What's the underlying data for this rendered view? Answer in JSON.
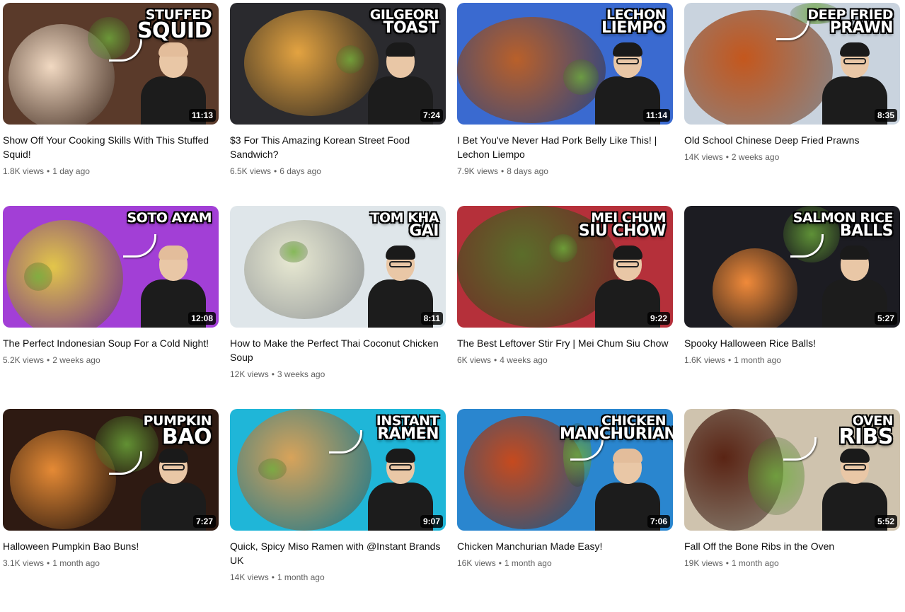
{
  "videos": [
    {
      "thumb_text_1": "Stuffed",
      "thumb_text_2": "Squid",
      "duration": "11:13",
      "title": "Show Off Your Cooking Skills With This Stuffed Squid!",
      "views": "1.8K views",
      "age": "1 day ago",
      "bg": "#5a3a2a",
      "food": "#f1d9c2"
    },
    {
      "thumb_text_1": "Gilgeori",
      "thumb_text_2": "Toast",
      "duration": "7:24",
      "title": "$3 For This Amazing Korean Street Food Sandwich?",
      "views": "6.5K views",
      "age": "6 days ago",
      "bg": "#2a2a2e",
      "food": "#e3a341"
    },
    {
      "thumb_text_1": "Lechon",
      "thumb_text_2": "Liempo",
      "duration": "11:14",
      "title": "I Bet You've Never Had Pork Belly Like This! | Lechon Liempo",
      "views": "7.9K views",
      "age": "8 days ago",
      "bg": "#3a6ad0",
      "food": "#b9602a"
    },
    {
      "thumb_text_1": "Deep Fried",
      "thumb_text_2": "Prawn",
      "duration": "8:35",
      "title": "Old School Chinese Deep Fried Prawns",
      "views": "14K views",
      "age": "2 weeks ago",
      "bg": "#c9d3de",
      "food": "#c4571d"
    },
    {
      "thumb_text_1": "Soto Ayam",
      "thumb_text_2": "",
      "duration": "12:08",
      "title": "The Perfect Indonesian Soup For a Cold Night!",
      "views": "5.2K views",
      "age": "2 weeks ago",
      "bg": "#a23fd6",
      "food": "#e3c64a"
    },
    {
      "thumb_text_1": "Tom Kha",
      "thumb_text_2": "Gai",
      "duration": "8:11",
      "title": "How to Make the Perfect Thai Coconut Chicken Soup",
      "views": "12K views",
      "age": "3 weeks ago",
      "bg": "#dfe6ea",
      "food": "#e8e9d2"
    },
    {
      "thumb_text_1": "Mei Chum",
      "thumb_text_2": "Siu Chow",
      "duration": "9:22",
      "title": "The Best Leftover Stir Fry | Mei Chum Siu Chow",
      "views": "6K views",
      "age": "4 weeks ago",
      "bg": "#b5303a",
      "food": "#5b6d2a"
    },
    {
      "thumb_text_1": "Salmon Rice",
      "thumb_text_2": "Balls",
      "duration": "5:27",
      "title": "Spooky Halloween Rice Balls!",
      "views": "1.6K views",
      "age": "1 month ago",
      "bg": "#1c1c22",
      "food": "#f08a3a"
    },
    {
      "thumb_text_1": "Pumpkin",
      "thumb_text_2": "Bao",
      "duration": "7:27",
      "title": "Halloween Pumpkin Bao Buns!",
      "views": "3.1K views",
      "age": "1 month ago",
      "bg": "#2e1a12",
      "food": "#e58a35"
    },
    {
      "thumb_text_1": "Instant",
      "thumb_text_2": "Ramen",
      "duration": "9:07",
      "title": "Quick, Spicy Miso Ramen with @Instant Brands UK",
      "views": "14K views",
      "age": "1 month ago",
      "bg": "#1fb6d8",
      "food": "#d8a35a"
    },
    {
      "thumb_text_1": "Chicken",
      "thumb_text_2": "Manchurian",
      "duration": "7:06",
      "title": "Chicken Manchurian Made Easy!",
      "views": "16K views",
      "age": "1 month ago",
      "bg": "#2a86cf",
      "food": "#c64a1e"
    },
    {
      "thumb_text_1": "Oven",
      "thumb_text_2": "Ribs",
      "duration": "5:52",
      "title": "Fall Off the Bone Ribs in the Oven",
      "views": "19K views",
      "age": "1 month ago",
      "bg": "#cfc3ae",
      "food": "#5a2414"
    }
  ]
}
